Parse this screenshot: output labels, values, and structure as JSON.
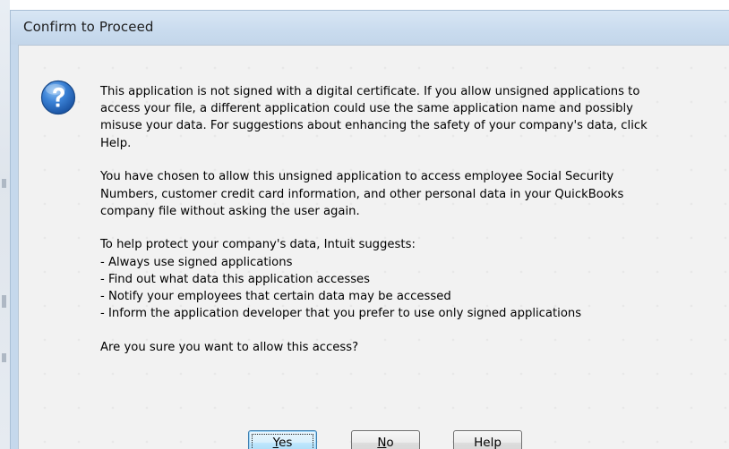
{
  "window": {
    "title": "Confirm to Proceed"
  },
  "message": {
    "paragraph1": [
      "This application is not signed with a digital certificate.  If you allow unsigned applications to",
      "access your file, a different application could use the same application name and possibly",
      "misuse your data.  For suggestions about enhancing the safety of your company's data, click",
      "Help."
    ],
    "paragraph2": [
      "You have chosen to allow this unsigned application to access employee Social Security",
      "Numbers, customer credit card information, and other personal data in your QuickBooks",
      "company file without asking the user again."
    ],
    "paragraph3_intro": "To help protect your company's data, Intuit suggests:",
    "suggestions": [
      "- Always use signed applications",
      "- Find out what data this application accesses",
      "- Notify your employees that certain data may be accessed",
      "- Inform the application developer that you prefer to use only signed applications"
    ],
    "question": "Are you sure you want to allow this access?"
  },
  "buttons": {
    "yes": {
      "mnemonic": "Y",
      "rest": "es"
    },
    "no": {
      "mnemonic": "N",
      "rest": "o"
    },
    "help": {
      "label": "Help"
    }
  },
  "icons": {
    "dialog_icon": "question-icon"
  },
  "colors": {
    "frame": "#c5d8ec",
    "client": "#f2f2f2",
    "icon_blue": "#2a6fc1",
    "default_button_border": "#3c7fb1"
  }
}
